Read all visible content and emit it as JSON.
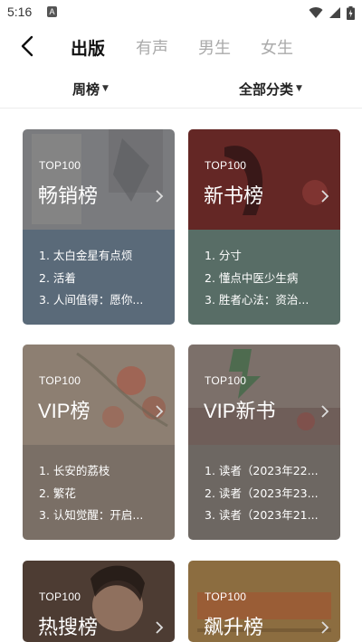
{
  "status_bar": {
    "time": "5:16",
    "notification_badge": "A"
  },
  "nav": {
    "back_icon": "chevron-left-icon",
    "tabs": [
      {
        "label": "出版",
        "active": true
      },
      {
        "label": "有声",
        "active": false
      },
      {
        "label": "男生",
        "active": false
      },
      {
        "label": "女生",
        "active": false
      }
    ]
  },
  "filters": [
    {
      "label": "周榜"
    },
    {
      "label": "全部分类"
    }
  ],
  "cards": [
    {
      "tag": "TOP100",
      "title": "畅销榜",
      "items": [
        "1. 太白金星有点烦",
        "2. 活着",
        "3. 人间值得：愿你..."
      ],
      "top_color": "#77787b",
      "bottom_color": "#5a6a79"
    },
    {
      "tag": "TOP100",
      "title": "新书榜",
      "items": [
        "1. 分寸",
        "2. 懂点中医少生病",
        "3. 胜者心法：资治..."
      ],
      "top_color": "#6e2b2a",
      "bottom_color": "#586d66"
    },
    {
      "tag": "TOP100",
      "title": "VIP榜",
      "items": [
        "1. 长安的荔枝",
        "2. 繁花",
        "3. 认知觉醒：开启..."
      ],
      "top_color": "#8a7d6f",
      "bottom_color": "#7a6f66"
    },
    {
      "tag": "TOP100",
      "title": "VIP新书",
      "items": [
        "1. 读者（2023年22...",
        "2. 读者（2023年23...",
        "3. 读者（2023年21..."
      ],
      "top_color": "#7b6f68",
      "bottom_color": "#6d6762"
    },
    {
      "tag": "TOP100",
      "title": "热搜榜",
      "items": [],
      "top_color": "#4f3e35",
      "bottom_color": "#55463e"
    },
    {
      "tag": "TOP100",
      "title": "飙升榜",
      "items": [],
      "top_color": "#8a6a3c",
      "bottom_color": "#7c6340"
    }
  ]
}
